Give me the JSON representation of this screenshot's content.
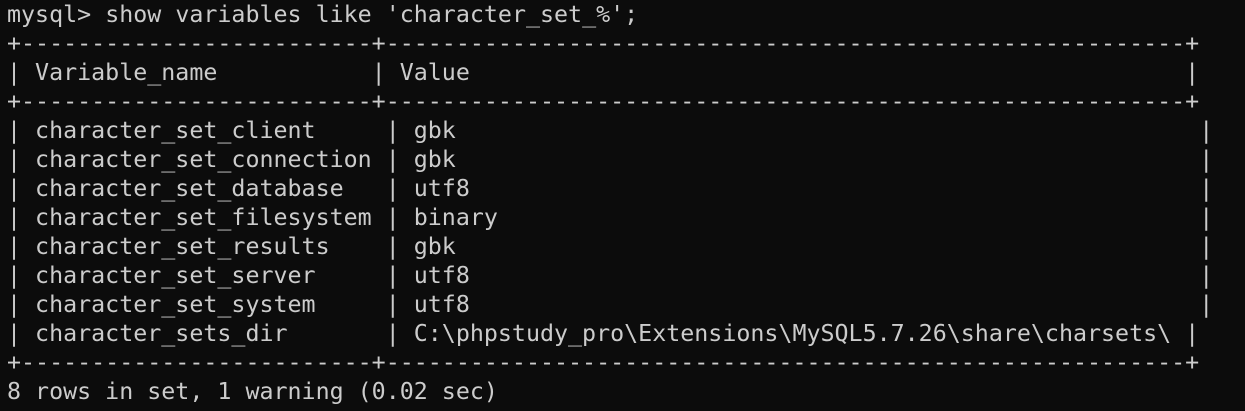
{
  "terminal": {
    "prompt": "mysql> ",
    "command": "show variables like 'character_set_%';"
  },
  "table": {
    "border": "+-------------------------+---------------------------------------------------------+",
    "header": "| Variable_name           | Value                                                   |",
    "rows": [
      "| character_set_client     | gbk                                                     |",
      "| character_set_connection | gbk                                                     |",
      "| character_set_database   | utf8                                                    |",
      "| character_set_filesystem | binary                                                  |",
      "| character_set_results    | gbk                                                     |",
      "| character_set_server     | utf8                                                    |",
      "| character_set_system     | utf8                                                    |",
      "| character_sets_dir       | C:\\phpstudy_pro\\Extensions\\MySQL5.7.26\\share\\charsets\\ |"
    ],
    "columns": [
      "Variable_name",
      "Value"
    ],
    "data": [
      [
        "character_set_client",
        "gbk"
      ],
      [
        "character_set_connection",
        "gbk"
      ],
      [
        "character_set_database",
        "utf8"
      ],
      [
        "character_set_filesystem",
        "binary"
      ],
      [
        "character_set_results",
        "gbk"
      ],
      [
        "character_set_server",
        "utf8"
      ],
      [
        "character_set_system",
        "utf8"
      ],
      [
        "character_sets_dir",
        "C:\\phpstudy_pro\\Extensions\\MySQL5.7.26\\share\\charsets\\"
      ]
    ]
  },
  "status": "8 rows in set, 1 warning (0.02 sec)",
  "colors": {
    "background": "#0c0c0c",
    "foreground": "#cccccc"
  }
}
